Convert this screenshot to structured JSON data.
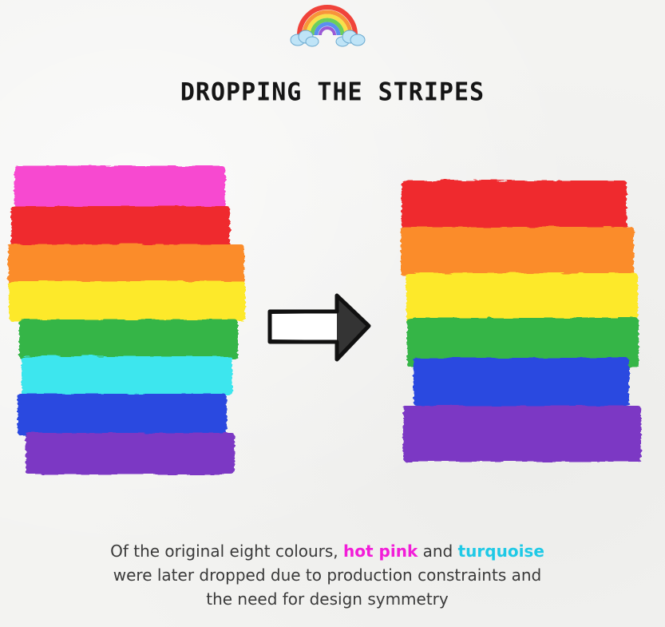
{
  "title": "DROPPING THE STRIPES",
  "original_stripes": [
    {
      "color": "#f74ad0",
      "name": "hot pink"
    },
    {
      "color": "#ef2b2e",
      "name": "red"
    },
    {
      "color": "#fb8c2c",
      "name": "orange"
    },
    {
      "color": "#fde92a",
      "name": "yellow"
    },
    {
      "color": "#35b547",
      "name": "green"
    },
    {
      "color": "#3ee6ee",
      "name": "turquoise"
    },
    {
      "color": "#2a48e0",
      "name": "blue"
    },
    {
      "color": "#7b38c4",
      "name": "violet"
    }
  ],
  "remaining_stripes": [
    {
      "color": "#ef2b2e",
      "name": "red"
    },
    {
      "color": "#fb8c2c",
      "name": "orange"
    },
    {
      "color": "#fde92a",
      "name": "yellow"
    },
    {
      "color": "#35b547",
      "name": "green"
    },
    {
      "color": "#2a48e0",
      "name": "blue"
    },
    {
      "color": "#7b38c4",
      "name": "violet"
    }
  ],
  "caption": {
    "part1": "Of the original eight colours,",
    "hot_pink": "hot pink",
    "hot_pink_color": "#f21dd8",
    "and": "and",
    "turquoise": "turquoise",
    "turquoise_color": "#1fc9e6",
    "part2": "were later dropped due to production constraints and",
    "part3": "the need for design symmetry"
  },
  "icons": {
    "logo": "rainbow-with-clouds-icon",
    "arrow": "right-arrow-icon"
  }
}
